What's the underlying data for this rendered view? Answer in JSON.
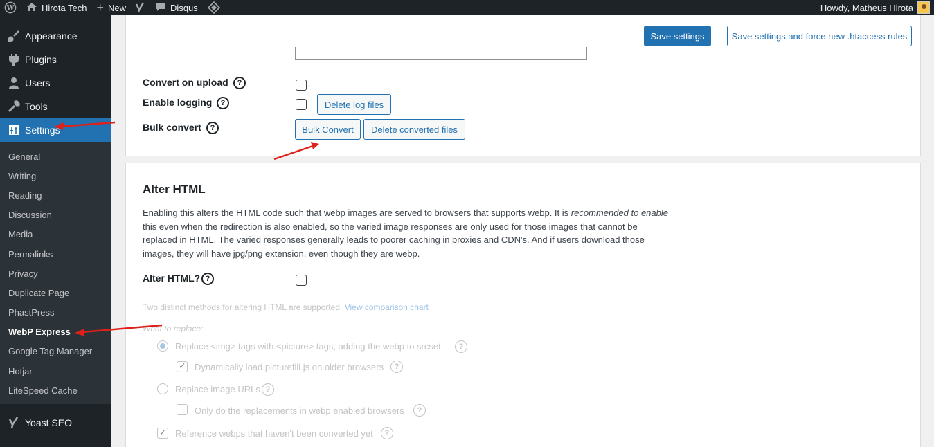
{
  "adminbar": {
    "site_name": "Hirota Tech",
    "new_label": "New",
    "disqus_label": "Disqus",
    "howdy": "Howdy, Matheus Hirota"
  },
  "sidebar": {
    "menu_top": [
      {
        "label": "Appearance",
        "icon": "paintbrush-icon"
      },
      {
        "label": "Plugins",
        "icon": "plugin-icon"
      },
      {
        "label": "Users",
        "icon": "users-icon"
      },
      {
        "label": "Tools",
        "icon": "wrench-icon"
      },
      {
        "label": "Settings",
        "icon": "settings-icon"
      }
    ],
    "submenu": [
      "General",
      "Writing",
      "Reading",
      "Discussion",
      "Media",
      "Permalinks",
      "Privacy",
      "Duplicate Page",
      "PhastPress",
      "WebP Express",
      "Google Tag Manager",
      "Hotjar",
      "LiteSpeed Cache"
    ],
    "yoast_label": "Yoast SEO"
  },
  "toolbar": {
    "save_label": "Save settings",
    "save_force_label": "Save settings and force new .htaccess rules"
  },
  "conversion": {
    "convert_on_upload": "Convert on upload",
    "enable_logging": "Enable logging",
    "delete_log_label": "Delete log files",
    "bulk_convert": "Bulk convert",
    "bulk_convert_btn": "Bulk Convert",
    "delete_converted_btn": "Delete converted files"
  },
  "alter_html": {
    "title": "Alter HTML",
    "desc_part1": "Enabling this alters the HTML code such that webp images are served to browsers that supports webp. It is ",
    "desc_italic": "recommended to enable",
    "desc_part2": " this even when the redirection is also enabled, so the varied image responses are only used for those images that cannot be replaced in HTML. The varied responses generally leads to poorer caching in proxies and CDN's. And if users download those images, they will have jpg/png extension, even though they are webp.",
    "alter_label": "Alter HTML?",
    "methods_text": "Two distinct methods for altering HTML are supported.",
    "comparison_link": "View comparison chart",
    "what_to_replace": "What to replace:",
    "opt_picture": "Replace <img> tags with <picture> tags, adding the webp to srcset.",
    "opt_picturefill": "Dynamically load picturefill.js on older browsers",
    "opt_urls": "Replace image URLs",
    "opt_only_enabled": "Only do the replacements in webp enabled browsers",
    "opt_reference": "Reference webps that haven't been converted yet"
  }
}
